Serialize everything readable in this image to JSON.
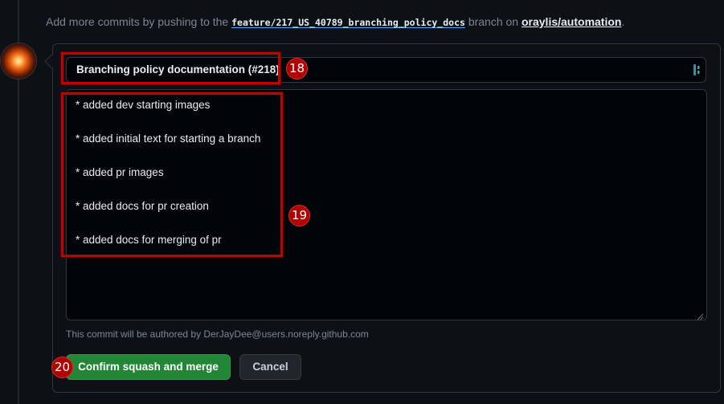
{
  "info": {
    "prefix": "Add more commits by pushing to the",
    "branch": "feature/217_US_40789_branching_policy_docs",
    "middle": "branch on",
    "repo": "oraylis/automation",
    "suffix": "."
  },
  "commit": {
    "title_value": "Branching policy documentation (#218)",
    "body_lines": [
      "* added dev starting images",
      "* added initial text for starting a branch",
      "* added pr images",
      "* added docs for pr creation",
      "* added docs for merging of pr"
    ],
    "author_note": "This commit will be authored by DerJayDee@users.noreply.github.com"
  },
  "buttons": {
    "confirm_label": "Confirm squash and merge",
    "cancel_label": "Cancel"
  },
  "annotations": {
    "title_marker": "18",
    "body_marker": "19",
    "confirm_marker": "20",
    "marker_color": "#b10000"
  },
  "colors": {
    "merge_green": "#238636",
    "background": "#0d1117"
  },
  "icons": {
    "avatar": "user-avatar",
    "input_side": "password-manager-icon",
    "resize": "resize-grip-icon"
  }
}
